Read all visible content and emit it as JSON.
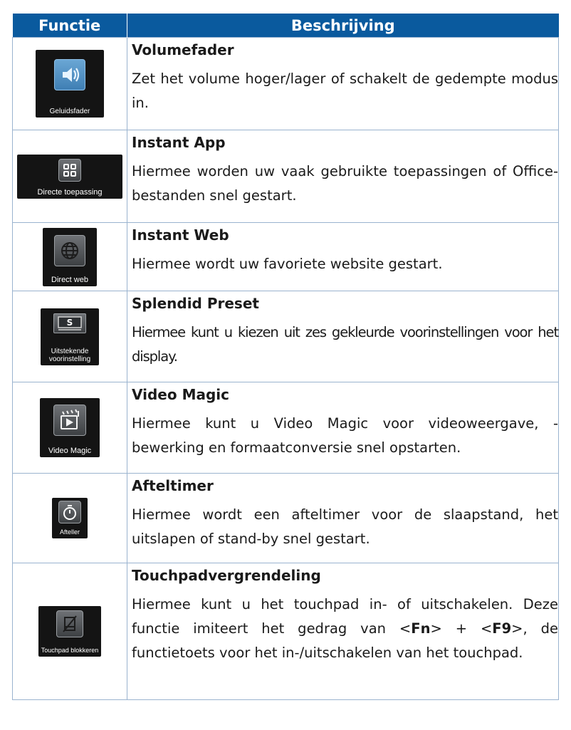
{
  "header": {
    "col1": "Functie",
    "col2": "Beschrijving"
  },
  "rows": [
    {
      "caption": "Geluidsfader",
      "icon": "speaker-icon",
      "title": "Volumefader",
      "desc": "Zet het volume hoger/lager of schakelt de gedempte modus in."
    },
    {
      "caption": "Directe toepassing",
      "icon": "app-grid-icon",
      "title": "Instant App",
      "desc": "Hiermee worden uw vaak gebruikte toepassingen of Office-bestanden snel gestart."
    },
    {
      "caption": "Direct web",
      "icon": "globe-icon",
      "title": "Instant Web",
      "desc": "Hiermee wordt uw favoriete website gestart."
    },
    {
      "caption": "Uitstekende voorinstelling",
      "icon": "splendid-icon",
      "title": "Splendid Preset",
      "desc": "Hiermee kunt u kiezen uit zes gekleurde voorinstellingen voor het display."
    },
    {
      "caption": "Video Magic",
      "icon": "video-clapper-icon",
      "title": "Video Magic",
      "desc": "Hiermee kunt u Video Magic voor videoweergave, -bewerking en formaatconversie snel opstarten."
    },
    {
      "caption": "Afteller",
      "icon": "stopwatch-icon",
      "title": "Afteltimer",
      "desc": "Hiermee wordt een afteltimer voor de slaapstand, het uitslapen of stand-by snel gestart."
    },
    {
      "caption": "Touchpad blokkeren",
      "icon": "touchpad-lock-icon",
      "title": "Touchpadvergrendeling",
      "desc_a": "Hiermee kunt u het touchpad in- of uitschakelen. Deze functie imiteert het gedrag van <",
      "key1": "Fn",
      "desc_b": "> + <",
      "key2": "F9",
      "desc_c": ">, de functietoets voor het in-/uitschakelen van het touchpad."
    }
  ]
}
